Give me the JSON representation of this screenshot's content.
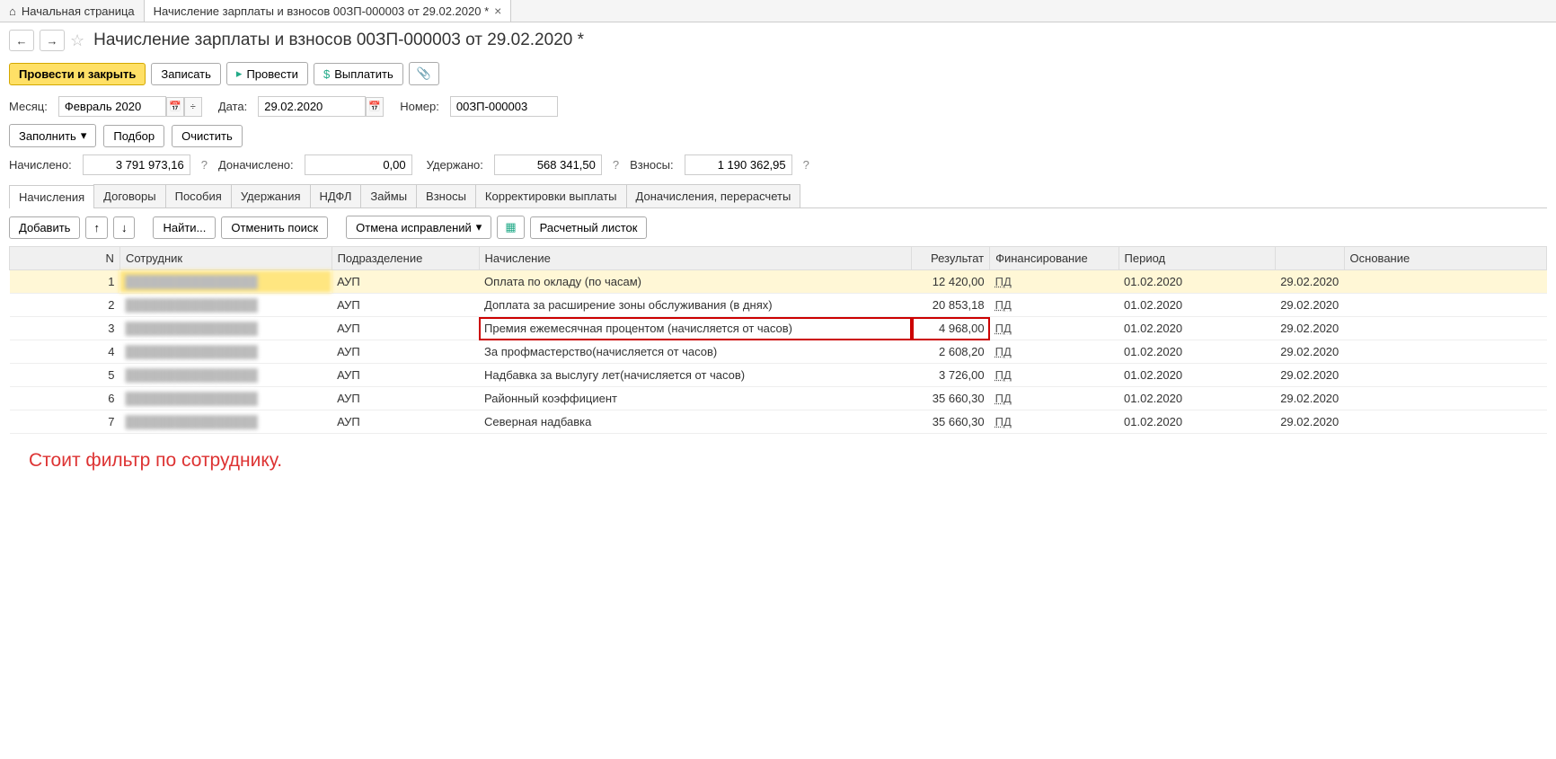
{
  "tabs": {
    "home": "Начальная страница",
    "doc": "Начисление зарплаты и взносов 00ЗП-000003 от 29.02.2020 *"
  },
  "title": "Начисление зарплаты и взносов 00ЗП-000003 от 29.02.2020 *",
  "toolbar": {
    "post_close": "Провести и закрыть",
    "save": "Записать",
    "post": "Провести",
    "pay": "Выплатить"
  },
  "fields": {
    "month_label": "Месяц:",
    "month_value": "Февраль 2020",
    "date_label": "Дата:",
    "date_value": "29.02.2020",
    "number_label": "Номер:",
    "number_value": "00ЗП-000003"
  },
  "fill_bar": {
    "fill": "Заполнить",
    "pick": "Подбор",
    "clear": "Очистить"
  },
  "totals": {
    "accrued_label": "Начислено:",
    "accrued": "3 791 973,16",
    "extra_label": "Доначислено:",
    "extra": "0,00",
    "withheld_label": "Удержано:",
    "withheld": "568 341,50",
    "contrib_label": "Взносы:",
    "contrib": "1 190 362,95"
  },
  "sub_tabs": [
    "Начисления",
    "Договоры",
    "Пособия",
    "Удержания",
    "НДФЛ",
    "Займы",
    "Взносы",
    "Корректировки выплаты",
    "Доначисления, перерасчеты"
  ],
  "actions": {
    "add": "Добавить",
    "find": "Найти...",
    "cancel_search": "Отменить поиск",
    "cancel_fix": "Отмена исправлений",
    "payslip": "Расчетный листок"
  },
  "columns": {
    "n": "N",
    "emp": "Сотрудник",
    "dep": "Подразделение",
    "accr": "Начисление",
    "res": "Результат",
    "fin": "Финансирование",
    "period": "Период",
    "base": "Основание"
  },
  "rows": [
    {
      "n": "1",
      "dep": "АУП",
      "accr": "Оплата по окладу (по часам)",
      "res": "12 420,00",
      "fin": "ПД",
      "p1": "01.02.2020",
      "p2": "29.02.2020"
    },
    {
      "n": "2",
      "dep": "АУП",
      "accr": "Доплата за расширение зоны обслуживания (в днях)",
      "res": "20 853,18",
      "fin": "ПД",
      "p1": "01.02.2020",
      "p2": "29.02.2020"
    },
    {
      "n": "3",
      "dep": "АУП",
      "accr": "Премия ежемесячная процентом (начисляется от часов)",
      "res": "4 968,00",
      "fin": "ПД",
      "p1": "01.02.2020",
      "p2": "29.02.2020"
    },
    {
      "n": "4",
      "dep": "АУП",
      "accr": "За профмастерство(начисляется от часов)",
      "res": "2 608,20",
      "fin": "ПД",
      "p1": "01.02.2020",
      "p2": "29.02.2020"
    },
    {
      "n": "5",
      "dep": "АУП",
      "accr": "Надбавка за выслугу лет(начисляется от часов)",
      "res": "3 726,00",
      "fin": "ПД",
      "p1": "01.02.2020",
      "p2": "29.02.2020"
    },
    {
      "n": "6",
      "dep": "АУП",
      "accr": "Районный коэффициент",
      "res": "35 660,30",
      "fin": "ПД",
      "p1": "01.02.2020",
      "p2": "29.02.2020"
    },
    {
      "n": "7",
      "dep": "АУП",
      "accr": "Северная надбавка",
      "res": "35 660,30",
      "fin": "ПД",
      "p1": "01.02.2020",
      "p2": "29.02.2020"
    }
  ],
  "annotation": "Стоит фильтр по сотруднику."
}
